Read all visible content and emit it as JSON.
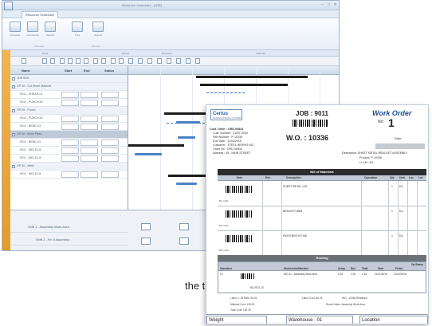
{
  "scheduler": {
    "title": "Resource Scheduler - [JOB]",
    "tab_label": "Resource Scheduler",
    "ribbon_buttons": [
      "Schedule",
      "Unschedule",
      "Refresh",
      "Print",
      "Options"
    ],
    "group_labels": [
      "Schedule",
      "Window"
    ],
    "strip_labels": [
      "Gantt",
      "Period",
      "Resource",
      "Calendar"
    ],
    "grid_headers": [
      "Name",
      "Start",
      "End",
      "Status"
    ],
    "rows": [
      {
        "kind": "group",
        "text": "JOB 9011"
      },
      {
        "kind": "group",
        "text": "OP 10 - Cut Sheet Material"
      },
      {
        "kind": "item",
        "text": "9011 - SHEAR-01"
      },
      {
        "kind": "item",
        "text": "9011 - PUNCH-02"
      },
      {
        "kind": "group",
        "text": "OP 20 - Punch"
      },
      {
        "kind": "item",
        "text": "9011 - PUNCH-02"
      },
      {
        "kind": "item",
        "text": "9011 - BEND-03"
      },
      {
        "kind": "sel",
        "text": "OP 30 - Bend Parts"
      },
      {
        "kind": "item",
        "text": "9011 - BEND-03"
      },
      {
        "kind": "item",
        "text": "9011 - WELD-04"
      },
      {
        "kind": "item",
        "text": "9011 - WELD-04"
      },
      {
        "kind": "group",
        "text": "OP 40 - Weld"
      },
      {
        "kind": "item",
        "text": "9011 - WELD-04"
      }
    ],
    "lower_rows": [
      "Shift 1 - Assembly Work Area",
      "Shift 2 - Fin 4 Assembly"
    ]
  },
  "caption": "the time per",
  "work_order": {
    "logo_text": "Certus",
    "logo_sub": "MANUFACTURING SYSTEMS",
    "title": "Work Order",
    "no_label": "No:",
    "no_value": "1",
    "job_label": "JOB : 9011",
    "wo_label": "W.O. : 10336",
    "date_label": "Date:",
    "info_left": [
      {
        "text": "Cust. Order : ORD-00834",
        "bold": true
      },
      {
        "text": "Cust. Number :   CUST-0042"
      },
      {
        "text": "Part Number :   P-10336"
      },
      {
        "text": "Due Date :   11/04/2016"
      },
      {
        "text": "Customer :   STEEL WORKS INC"
      },
      {
        "text": "Order No :   ORD-00834"
      },
      {
        "text": "Address :   45 - MAIN STREET"
      }
    ],
    "info_right": [
      {
        "text": "Description:   SHEET METAL BRACKET ASSEMBLY"
      },
      {
        "text": "Product:   P-10336"
      },
      {
        "text": "U.o.M.:   EA"
      }
    ],
    "bom_title": "Bill of Materials",
    "bom_headers": [
      "Item",
      "Rev",
      "Description",
      "Operation",
      "Qty",
      "Unit",
      "Loc",
      "Lot"
    ],
    "bom_rows": [
      {
        "desc": "SHEET METAL 14G",
        "qty": "1",
        "unit": "EA",
        "ref": "BC-1011"
      },
      {
        "desc": "BRACKET ARM",
        "qty": "1",
        "unit": "EA",
        "ref": "BC-1012"
      },
      {
        "desc": "FASTENER KIT M6",
        "qty": "1",
        "unit": "EA",
        "ref": "BC-1013"
      }
    ],
    "routing_title": "Routing",
    "routing_headers": [
      "Operation",
      "Workcentre/Machine",
      "Setup",
      "Run",
      "Total",
      "Start",
      "Finish",
      "Op Status"
    ],
    "routing_row": [
      "10",
      "WC-01 - Assembly Work Area",
      "0.25",
      "1.00",
      "1.25",
      "11/01/2016",
      "11/02/2016"
    ],
    "routing_ref": "BC-RTG-10",
    "summary": [
      "Labor:  1.25   Rate:  45.00",
      "Material Cost:  126.00",
      "Total Cost:  182.25",
      "Labor Cost: 56.25",
      "WO - 10336 Released",
      "Route Notes:  Assembly Work Area"
    ],
    "footer": [
      "Weight",
      "Warehouse : 01",
      "Location"
    ]
  }
}
